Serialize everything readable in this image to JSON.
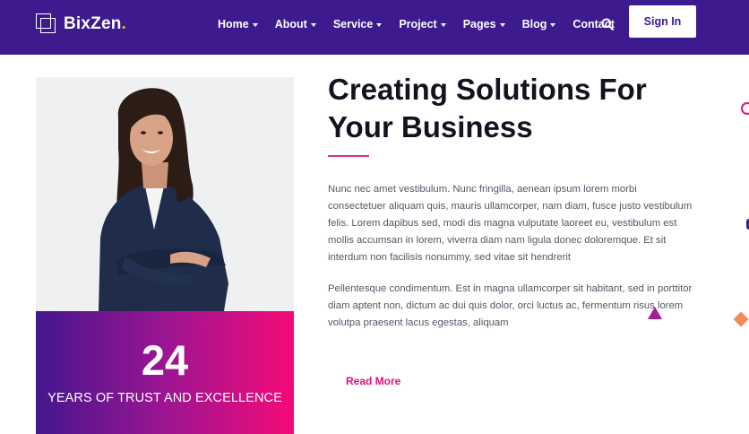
{
  "brand": {
    "name": "BixZen",
    "dot": ".",
    "accent_color": "#f7b52c",
    "nav_bg_color": "#3d1a8e"
  },
  "nav": {
    "items": [
      {
        "label": "Home",
        "has_dropdown": true
      },
      {
        "label": "About",
        "has_dropdown": true
      },
      {
        "label": "Service",
        "has_dropdown": true
      },
      {
        "label": "Project",
        "has_dropdown": true
      },
      {
        "label": "Pages",
        "has_dropdown": true
      },
      {
        "label": "Blog",
        "has_dropdown": true
      },
      {
        "label": "Contact",
        "has_dropdown": false
      }
    ],
    "search_icon": "search-icon",
    "signin_label": "Sign In"
  },
  "hero": {
    "photo_icon": "businesswoman-photo",
    "stat_number": "24",
    "stat_label": "YEARS OF TRUST AND EXCELLENCE",
    "heading": "Creating Solutions For Your Business",
    "paragraph_1": "Nunc nec amet vestibulum. Nunc fringilla, aenean ipsum lorem morbi consectetuer aliquam quis, mauris ullamcorper, nam diam, fusce justo vestibulum felis. Lorem dapibus sed, modi dis magna vulputate laoreet eu, vestibulum est mollis accumsan in lorem, viverra diam nam ligula donec doloremque. Et sit interdum non facilisis nonummy, sed vitae sit hendrerit",
    "paragraph_2": "Pellentesque condimentum. Est in magna ullamcorper sit habitant, sed in porttitor diam aptent non, dictum ac dui quis dolor, orci luctus ac, fermentum risus lorem volutpa praesent lacus egestas, aliquam",
    "read_more_label": "Read More",
    "gradient_colors": [
      "#44168e",
      "#9c1592",
      "#f50a78"
    ],
    "link_color": "#e8107c"
  }
}
